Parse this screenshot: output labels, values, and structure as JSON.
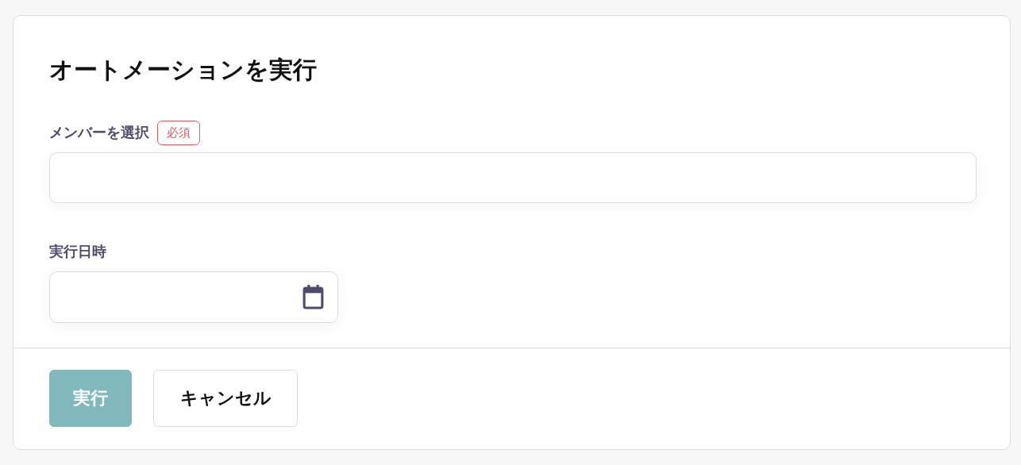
{
  "dialog": {
    "title": "オートメーションを実行",
    "fields": [
      {
        "kind": "text",
        "label": "メンバーを選択",
        "badge": "必須"
      },
      {
        "kind": "date",
        "label": "実行日時"
      }
    ],
    "buttons": [
      {
        "kind": "primary",
        "label": "実行",
        "disabled": true
      },
      {
        "kind": "secondary",
        "label": "キャンセル",
        "disabled": false
      }
    ]
  }
}
